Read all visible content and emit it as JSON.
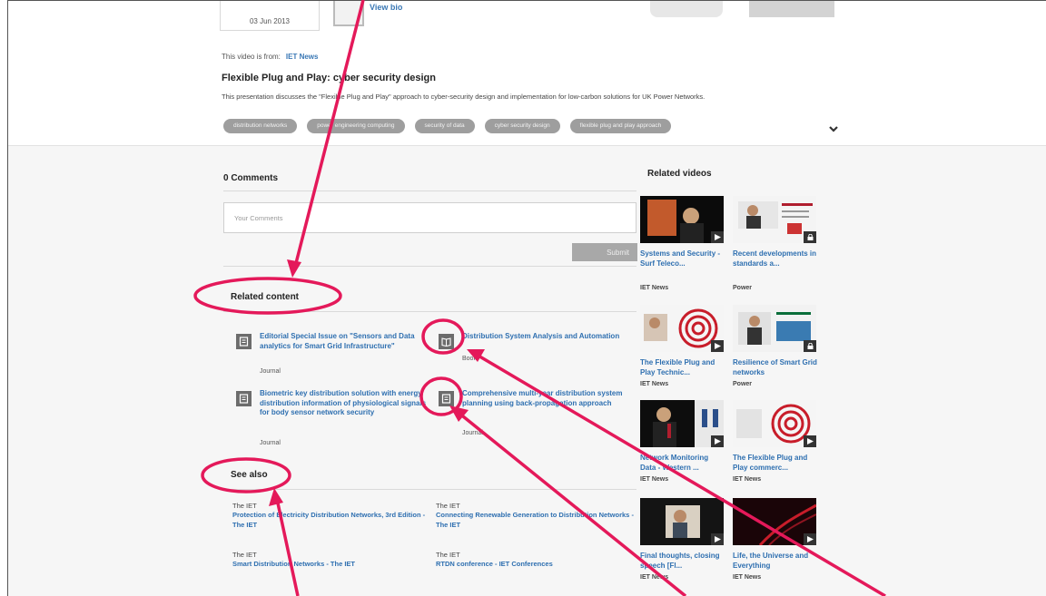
{
  "header": {
    "date": "03 Jun 2013",
    "view_link": "View bio"
  },
  "video": {
    "source_prefix": "This video is from:",
    "source_name": "IET News",
    "title": "Flexible Plug and Play: cyber security design",
    "description": "This presentation discusses the \"Flexible Plug and Play\" approach to cyber-security design and implementation for low-carbon solutions for UK Power Networks.",
    "tags": [
      "distribution networks",
      "power engineering computing",
      "security of data",
      "cyber security design",
      "flexible plug and play approach"
    ],
    "expand_icon": "chevron-down-icon"
  },
  "comments": {
    "title": "0 Comments",
    "placeholder": "Your Comments",
    "submit_label": "Submit"
  },
  "related_content": {
    "title": "Related content",
    "items": [
      {
        "title": "Editorial Special Issue on \"Sensors and Data analytics for Smart Grid Infrastructure\"",
        "type": "Journal",
        "icon": "journal-icon"
      },
      {
        "title": "Distribution System Analysis and Automation",
        "type": "Book",
        "icon": "book-icon"
      },
      {
        "title": "Biometric key distribution solution with energy distribution information of physiological signals for body sensor network security",
        "type": "Journal",
        "icon": "journal-icon"
      },
      {
        "title": "Comprehensive multi-year distribution system planning using back-propagation approach",
        "type": "Journal",
        "icon": "journal-icon"
      }
    ]
  },
  "see_also": {
    "title": "See also",
    "items": [
      {
        "source": "The IET",
        "title": "Protection of Electricity Distribution Networks, 3rd Edition - The IET"
      },
      {
        "source": "The IET",
        "title": "Connecting Renewable Generation to Distribution Networks - The IET"
      },
      {
        "source": "The IET",
        "title": "Smart Distribution Networks - The IET"
      },
      {
        "source": "The IET",
        "title": "RTDN conference - IET Conferences"
      }
    ]
  },
  "related_videos": {
    "title": "Related videos",
    "items": [
      {
        "title": "Systems and Security - Surf Teleco...",
        "channel": "IET News",
        "badge": "play-icon"
      },
      {
        "title": "Recent developments in standards a...",
        "channel": "Power",
        "badge": "lock-icon"
      },
      {
        "title": "The Flexible Plug and Play Technic...",
        "channel": "IET News",
        "badge": "play-icon"
      },
      {
        "title": "Resilience of Smart Grid networks",
        "channel": "Power",
        "badge": "lock-icon"
      },
      {
        "title": "Network Monitoring Data - Western ...",
        "channel": "IET News",
        "badge": "play-icon"
      },
      {
        "title": "The Flexible Plug and Play commerc...",
        "channel": "IET News",
        "badge": "play-icon"
      },
      {
        "title": "Final thoughts, closing speech [Fl...",
        "channel": "IET News",
        "badge": "play-icon"
      },
      {
        "title": "Life, the Universe and Everything",
        "channel": "IET News",
        "badge": "play-icon"
      }
    ]
  },
  "annotation_color": "#e4195a"
}
